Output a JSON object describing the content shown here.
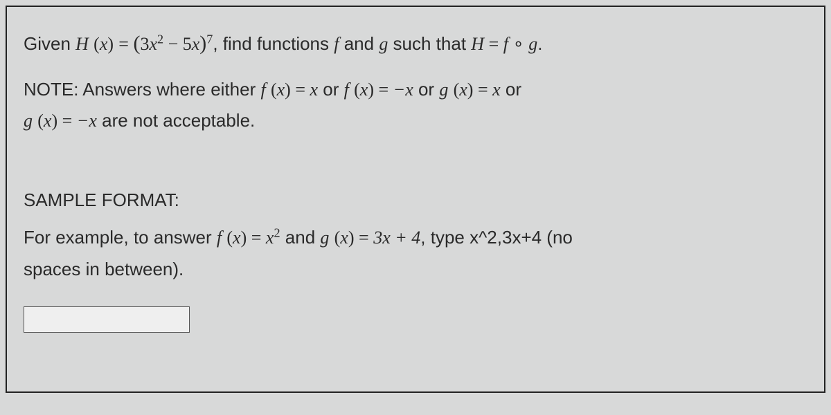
{
  "problem": {
    "given_prefix": "Given ",
    "H": "H",
    "lparen": "(",
    "x": "x",
    "rparen": ")",
    "eq": " = ",
    "open_big": "(",
    "term1_coef": "3",
    "term1_var": "x",
    "term1_pow": "2",
    "minus": " − ",
    "term2_coef": "5",
    "term2_var": "x",
    "close_big": ")",
    "outer_pow": "7",
    "prompt_mid": ", find functions ",
    "f": "f",
    "and": " and ",
    "g": "g",
    "such_that": " such that ",
    "Heq": "H",
    "compose_eq": " = ",
    "f2": "f",
    "circ": " ∘ ",
    "g2": "g",
    "period": "."
  },
  "note": {
    "prefix": "NOTE: Answers where either ",
    "f": "f",
    "lp": "(",
    "x": "x",
    "rp": ")",
    "eq": " = ",
    "x1": "x",
    "or1": " or ",
    "f2": "f",
    "eq2": " = ",
    "negx": "−x",
    "or2": " or ",
    "g": "g",
    "eq3": " = ",
    "x2": "x",
    "or3": " or",
    "gline2": "g",
    "eq4": " = ",
    "negx2": "−x",
    "tail": " are not acceptable."
  },
  "sample": {
    "heading": "SAMPLE FORMAT:",
    "prefix": "For example, to answer ",
    "f": "f",
    "lp": "(",
    "x": "x",
    "rp": ")",
    "eq": " = ",
    "xsq_base": "x",
    "xsq_pow": "2",
    "and": " and ",
    "g": "g",
    "eq2": " = ",
    "gexpr": "3x + 4",
    "tail": ", type x^2,3x+4 (no",
    "tail2": "spaces in between)."
  },
  "input": {
    "value": ""
  }
}
